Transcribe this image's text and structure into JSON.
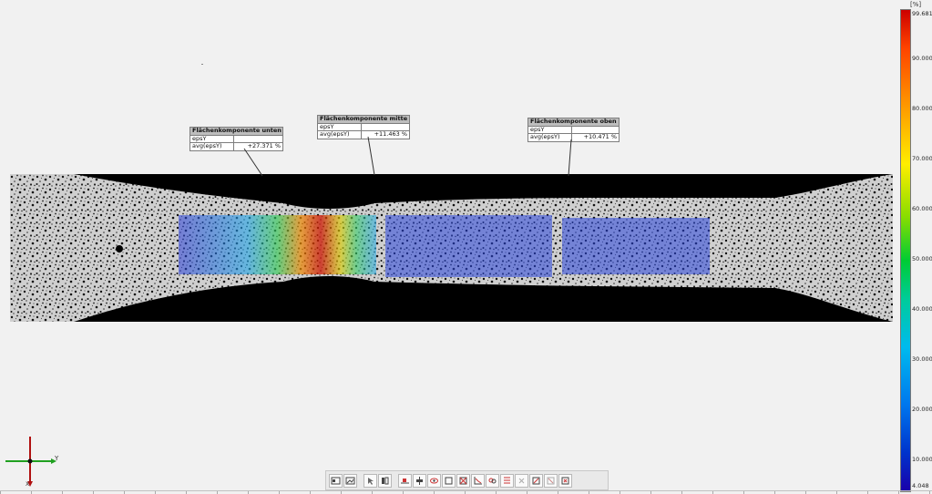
{
  "callouts": [
    {
      "title": "Flächenkomponente unten",
      "rows": [
        {
          "label": "epsY",
          "value": ""
        },
        {
          "label": "avg(epsY)",
          "value": "+27.371 %"
        }
      ]
    },
    {
      "title": "Flächenkomponente mitte",
      "rows": [
        {
          "label": "epsY",
          "value": ""
        },
        {
          "label": "avg(epsY)",
          "value": "+11.463 %"
        }
      ]
    },
    {
      "title": "Flächenkomponente oben",
      "rows": [
        {
          "label": "epsY",
          "value": ""
        },
        {
          "label": "avg(epsY)",
          "value": "+10.471 %"
        }
      ]
    }
  ],
  "scale": {
    "unit": "[%]",
    "max": "99.681",
    "min": "4.048",
    "ticks": [
      "90.000",
      "80.000",
      "70.000",
      "60.000",
      "50.000",
      "40.000",
      "30.000",
      "20.000",
      "10.000"
    ]
  },
  "axes": {
    "y_label": "Y",
    "x_label": "X"
  },
  "toolbar": {
    "icons": [
      "view-icon",
      "image-icon",
      "select-icon",
      "mirror-icon",
      "align-icon",
      "align-vertical-icon",
      "eye-icon",
      "rectangle-icon",
      "grid-icon",
      "chart-icon",
      "link-icon",
      "pattern-icon",
      "delete-icon",
      "layer-icon",
      "layer-remove-icon",
      "export-icon"
    ]
  }
}
